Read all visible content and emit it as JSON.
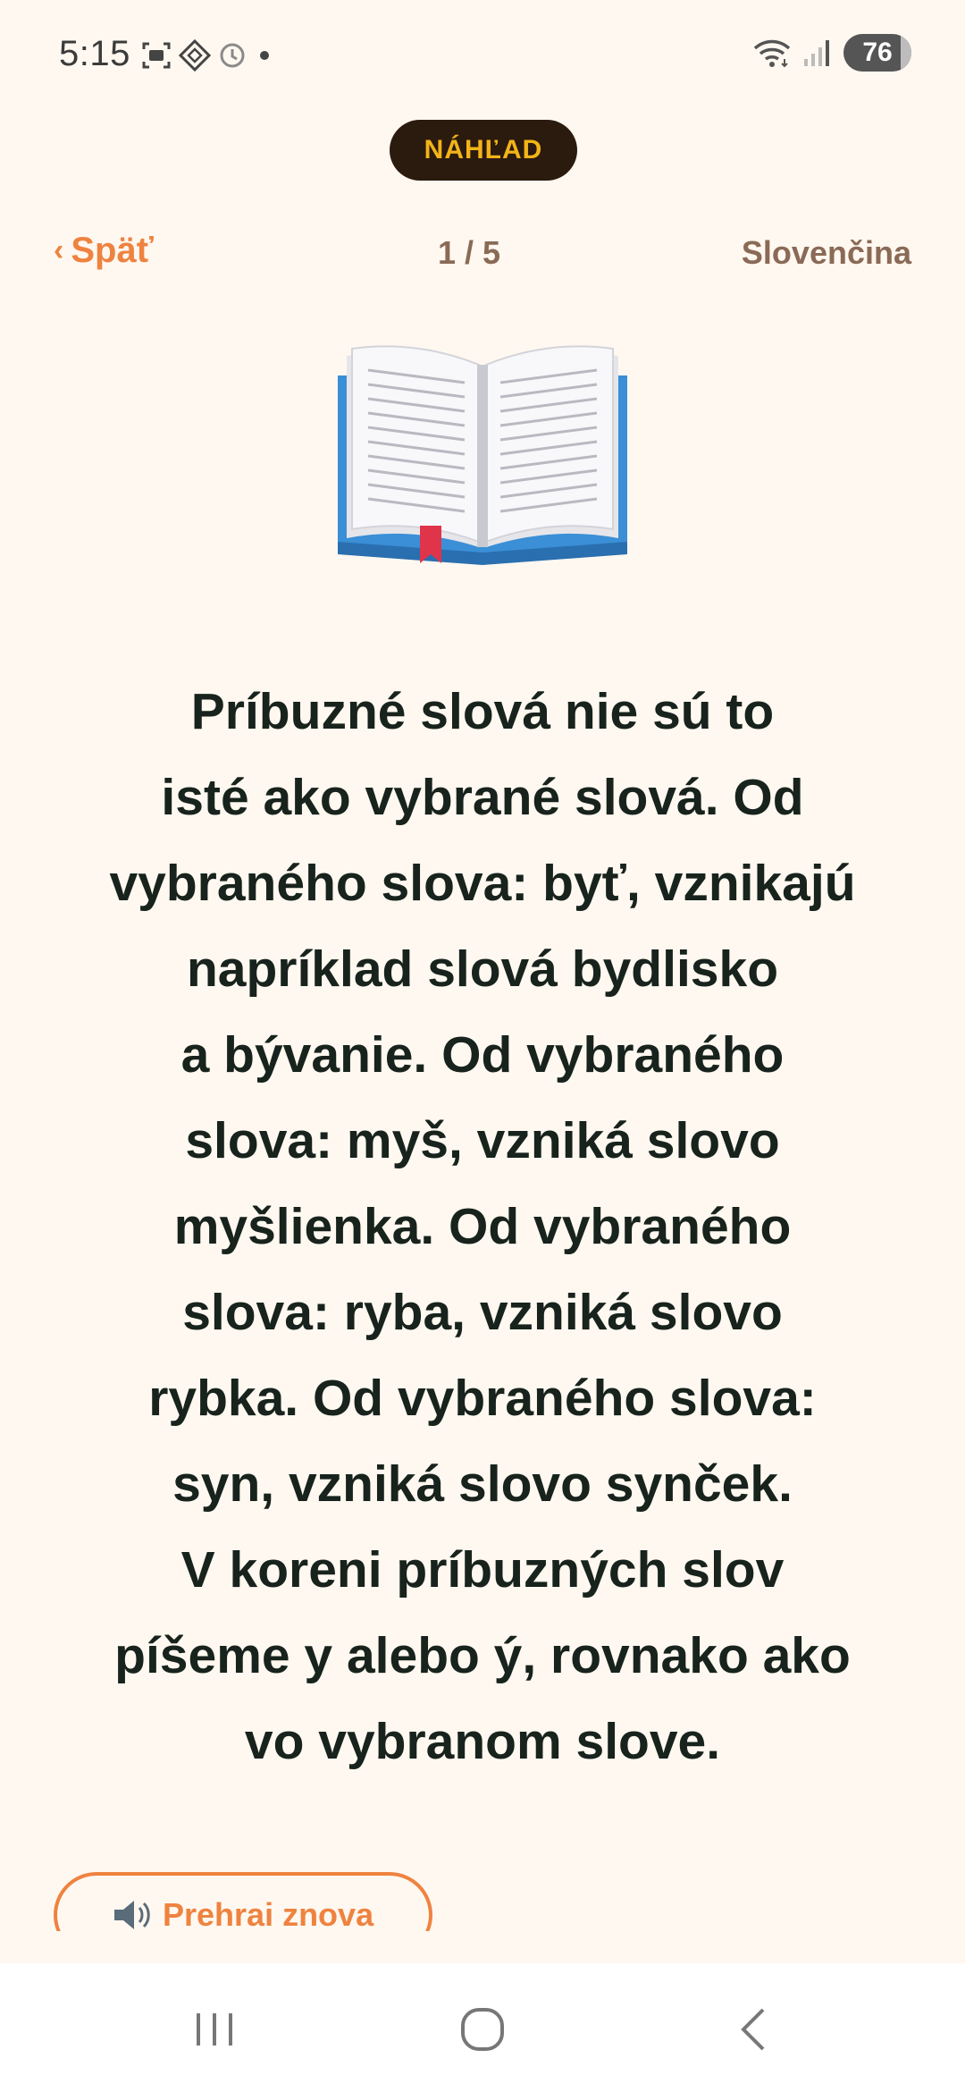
{
  "status_bar": {
    "time": "5:15",
    "battery": "76",
    "icons_left": [
      "screenshot-icon",
      "vpn-diamond-icon",
      "alarm-icon",
      "dot-icon"
    ],
    "icons_right": [
      "wifi-icon",
      "signal-icon",
      "battery-charging-icon"
    ]
  },
  "badge": {
    "label": "NÁHĽAD"
  },
  "nav": {
    "back_chevron": "‹",
    "back_label": "Späť",
    "page": "1 / 5",
    "language": "Slovenčina"
  },
  "illustration": {
    "icon": "open-book-icon"
  },
  "lesson": {
    "lines": [
      "Príbuzné slová nie sú to",
      "isté ako vybrané slová. Od",
      "vybraného slova: byť, vznikajú",
      "napríklad slová bydlisko",
      "a bývanie. Od vybraného",
      "slova: myš, vzniká slovo",
      "myšlienka. Od vybraného",
      "slova: ryba, vzniká slovo",
      "rybka. Od vybraného slova:",
      "syn, vzniká slovo synček.",
      "V koreni príbuzných slov",
      "píšeme y alebo ý, rovnako ako",
      "vo vybranom slove."
    ]
  },
  "replay": {
    "icon": "speaker-icon",
    "label": "Prehrai znova"
  },
  "system_nav": {
    "icons": [
      "recent-apps-icon",
      "home-icon",
      "back-icon"
    ]
  },
  "colors": {
    "background": "#fff8f0",
    "accent": "#ee8340",
    "badge_bg": "#2b1a0e",
    "badge_text": "#f2b418",
    "muted": "#8a6a56",
    "text": "#17231c"
  }
}
